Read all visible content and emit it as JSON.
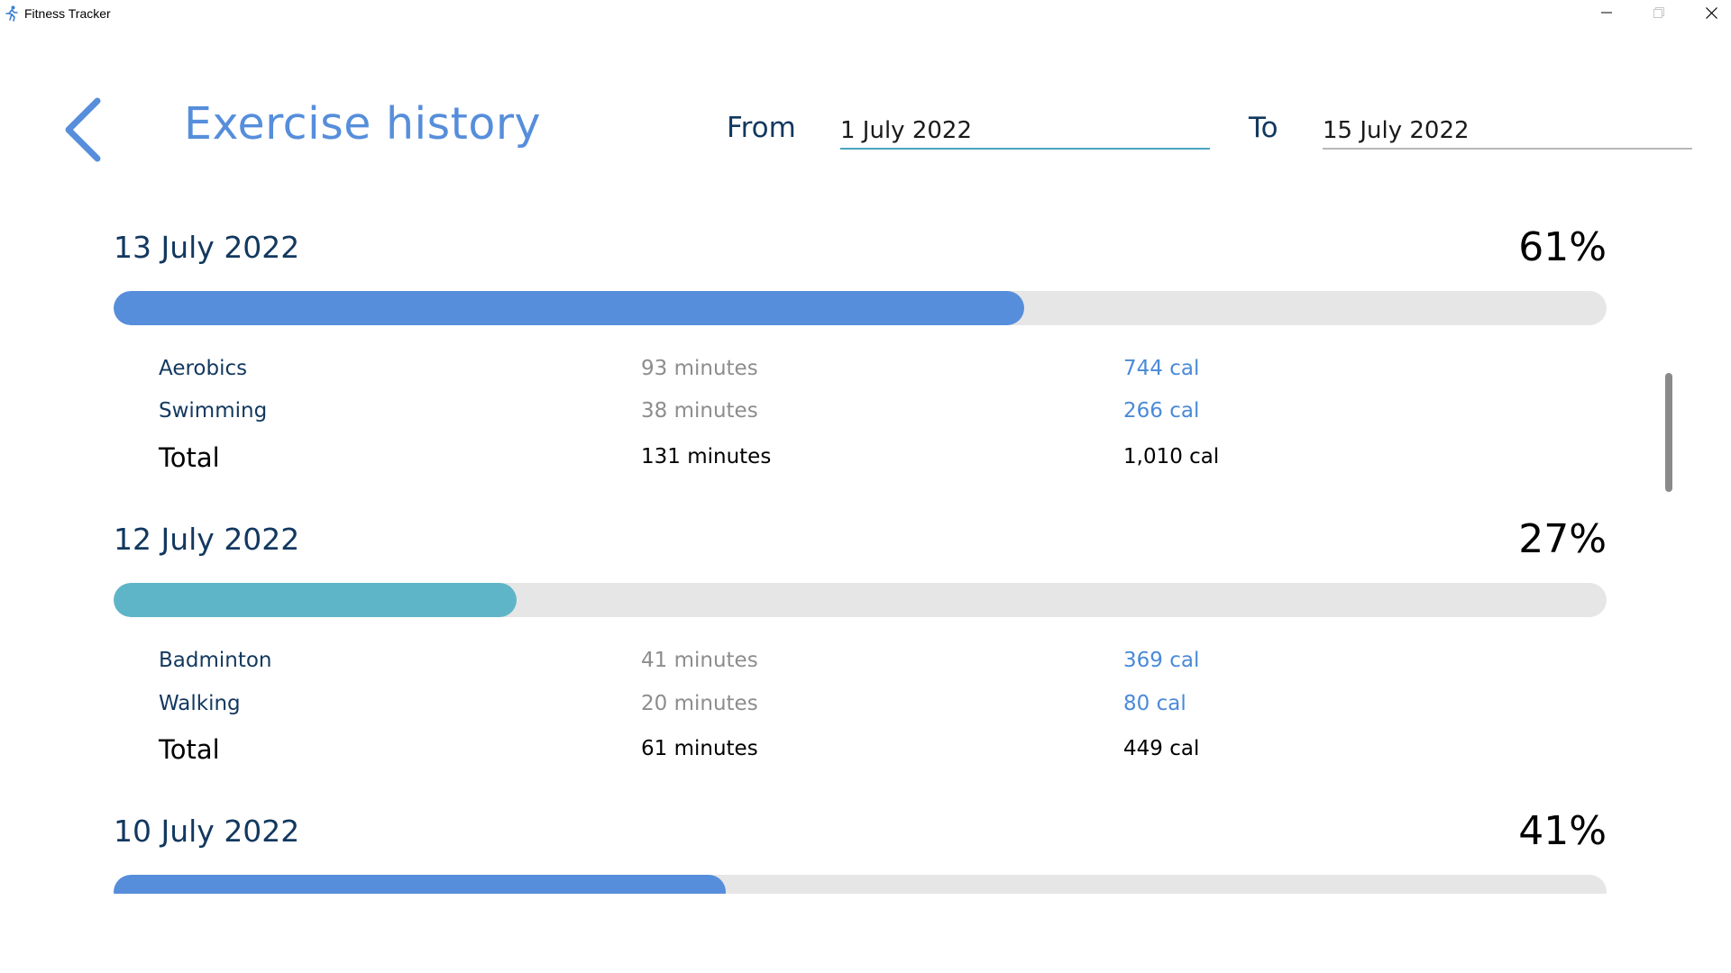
{
  "window": {
    "title": "Fitness Tracker"
  },
  "header": {
    "title": "Exercise history",
    "from_label": "From",
    "from_value": "1 July 2022",
    "to_label": "To",
    "to_value": "15 July 2022"
  },
  "colors": {
    "accent": "#568edb",
    "teal": "#5fb5c8",
    "navy": "#12385f",
    "track": "#e6e6e6"
  },
  "days": [
    {
      "date": "13 July 2022",
      "percent_label": "61%",
      "progress": 0.61,
      "bar_color": "#568edb",
      "rows": [
        {
          "name": "Aerobics",
          "minutes": "93 minutes",
          "cal": "744 cal"
        },
        {
          "name": "Swimming",
          "minutes": "38 minutes",
          "cal": "266 cal"
        }
      ],
      "total": {
        "label": "Total",
        "minutes": "131 minutes",
        "cal": "1,010 cal"
      }
    },
    {
      "date": "12 July 2022",
      "percent_label": "27%",
      "progress": 0.27,
      "bar_color": "#5fb5c8",
      "rows": [
        {
          "name": "Badminton",
          "minutes": "41 minutes",
          "cal": "369 cal"
        },
        {
          "name": "Walking",
          "minutes": "20 minutes",
          "cal": "80 cal"
        }
      ],
      "total": {
        "label": "Total",
        "minutes": "61 minutes",
        "cal": "449 cal"
      }
    },
    {
      "date": "10 July 2022",
      "percent_label": "41%",
      "progress": 0.41,
      "bar_color": "#568edb"
    }
  ]
}
